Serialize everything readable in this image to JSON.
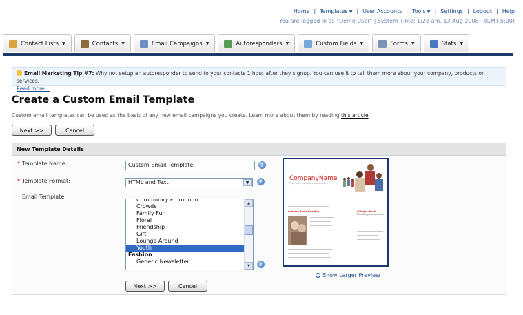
{
  "nav": {
    "links": [
      {
        "label": "Home",
        "dropdown": false
      },
      {
        "label": "Templates",
        "dropdown": true
      },
      {
        "label": "User Accounts",
        "dropdown": false
      },
      {
        "label": "Tools",
        "dropdown": true
      },
      {
        "label": "Settings",
        "dropdown": false
      },
      {
        "label": "Logout",
        "dropdown": false
      },
      {
        "label": "Help",
        "dropdown": false
      }
    ],
    "status": "You are logged in as \"Demo User\" | System Time: 1:28 am, 13 Aug 2008 - (GMT-5:00)"
  },
  "tabs": [
    {
      "label": "Contact Lists",
      "icon": "contact-lists-icon",
      "color": "#d9a441"
    },
    {
      "label": "Contacts",
      "icon": "contacts-icon",
      "color": "#8a6d3b"
    },
    {
      "label": "Email Campaigns",
      "icon": "email-campaigns-icon",
      "color": "#6d8fc4"
    },
    {
      "label": "Autoresponders",
      "icon": "autoresponders-icon",
      "color": "#5b9a56"
    },
    {
      "label": "Custom Fields",
      "icon": "custom-fields-icon",
      "color": "#7aa6d9"
    },
    {
      "label": "Forms",
      "icon": "forms-icon",
      "color": "#7d93b8"
    },
    {
      "label": "Stats",
      "icon": "stats-icon",
      "color": "#4a78c2"
    }
  ],
  "tip": {
    "title": "Email Marketing Tip #7:",
    "text": " Why not setup an autoresponder to send to your contacts 1 hour after they signup. You can use it to tell them more abour your company, products or services.",
    "link": "Read more..."
  },
  "page": {
    "title": "Create a Custom Email Template",
    "intro": "Custom email templates can be used as the basis of any new email campaigns you create. Learn more about them by reading ",
    "intro_link": "this article",
    "intro_end": "."
  },
  "buttons": {
    "next": "Next >>",
    "cancel": "Cancel"
  },
  "panel": {
    "heading": "New Template Details",
    "required_mark": "*",
    "name_label": "Template Name:",
    "name_value": "Custom Email Template",
    "format_label": "Template Format:",
    "format_value": "HTML and Text",
    "template_label": "Email Template:",
    "help_mark": "?",
    "template_options": [
      {
        "label": "Community Promotion",
        "group": false,
        "selected": false
      },
      {
        "label": "Crowds",
        "group": false,
        "selected": false
      },
      {
        "label": "Family Fun",
        "group": false,
        "selected": false
      },
      {
        "label": "Floral",
        "group": false,
        "selected": false
      },
      {
        "label": "Friendship",
        "group": false,
        "selected": false
      },
      {
        "label": "Gift",
        "group": false,
        "selected": false
      },
      {
        "label": "Lounge Around",
        "group": false,
        "selected": false
      },
      {
        "label": "Youth",
        "group": false,
        "selected": true
      },
      {
        "label": "Fashion",
        "group": true,
        "selected": false
      },
      {
        "label": "Generic Newsletter",
        "group": false,
        "selected": false
      }
    ],
    "preview": {
      "brand": "CompanyName",
      "tagline": "Type your company slogan here",
      "heading_left": "Content Block Heading",
      "heading_right": "Sidebar Block Heading",
      "show_larger": "Show Larger Preview"
    }
  }
}
